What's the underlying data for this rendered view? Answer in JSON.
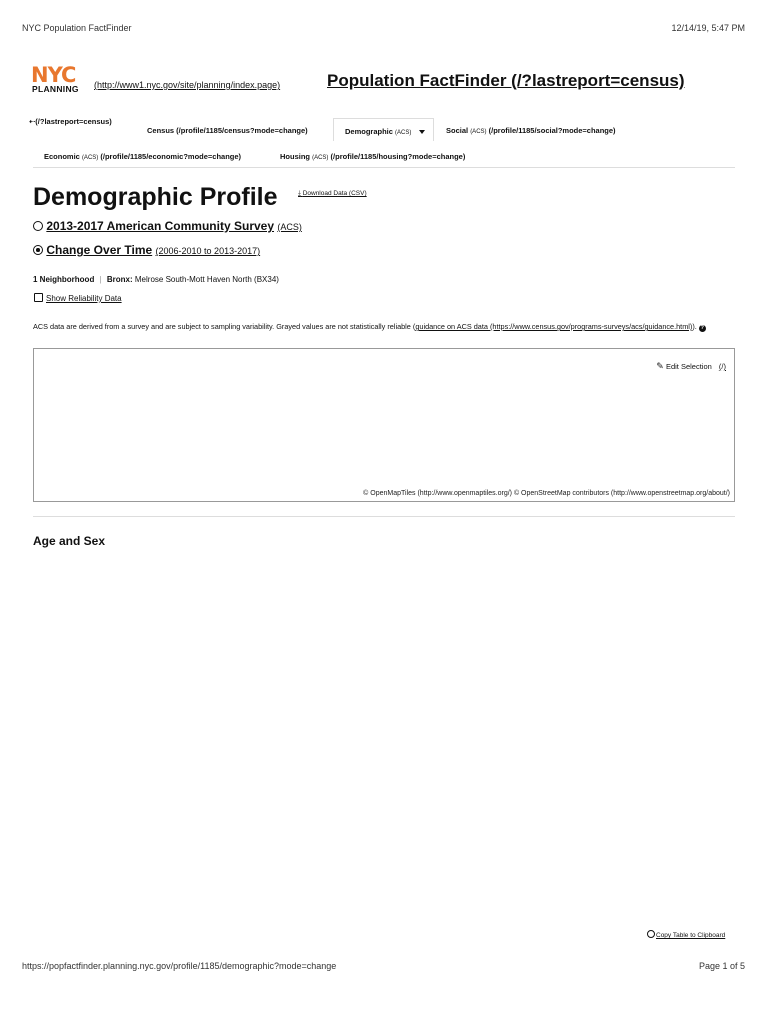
{
  "print_header": {
    "left": "NYC Population FactFinder",
    "right": "12/14/19, 5:47 PM"
  },
  "brand": {
    "logo_nyc": "NYC",
    "logo_planning": "PLANNING",
    "home_link": "(http://www1.nyc.gov/site/planning/index.page)",
    "site_title": "Population FactFinder (/?lastreport=census)",
    "logo_color": "#e8772e"
  },
  "nav": {
    "back": "(/?lastreport=census)",
    "census": "Census (/profile/1185/census?mode=change)",
    "demographic_label": "Demographic",
    "demographic_acs": "(ACS)",
    "social_label": "Social",
    "social_acs": "(ACS)",
    "social_href": "(/profile/1185/social?mode=change)",
    "economic_label": "Economic",
    "economic_acs": "(ACS)",
    "economic_href": "(/profile/1185/economic?mode=change)",
    "housing_label": "Housing",
    "housing_acs": "(ACS)",
    "housing_href": "(/profile/1185/housing?mode=change)"
  },
  "profile": {
    "title": "Demographic Profile",
    "download": "Download Data (CSV)",
    "option_survey_label": "2013-2017 American Community Survey",
    "option_survey_sub": "(ACS)",
    "option_change_label": "Change Over Time",
    "option_change_sub": "(2006-2010 to 2013-2017)",
    "neighborhood_count": "1 Neighborhood",
    "separator": "|",
    "borough": "Bronx:",
    "area": "Melrose South-Mott Haven North (BX34)",
    "show_reliability": "Show Reliability Data",
    "note_text": "ACS data are derived from a survey and are subject to sampling variability. Grayed values are not statistically reliable (",
    "note_link": "guidance on ACS data (https://www.census.gov/programs-surveys/acs/guidance.html)",
    "note_end": ")."
  },
  "map": {
    "edit_selection": "Edit Selection",
    "edit_href": "(/)",
    "attribution": "© OpenMapTiles (http://www.openmaptiles.org/) © OpenStreetMap contributors (http://www.openstreetmap.org/about/)"
  },
  "sections": {
    "age_sex": "Age and Sex",
    "copy_table": "Copy Table to Clipboard"
  },
  "print_footer": {
    "url": "https://popfactfinder.planning.nyc.gov/profile/1185/demographic?mode=change",
    "page": "Page 1 of 5"
  }
}
